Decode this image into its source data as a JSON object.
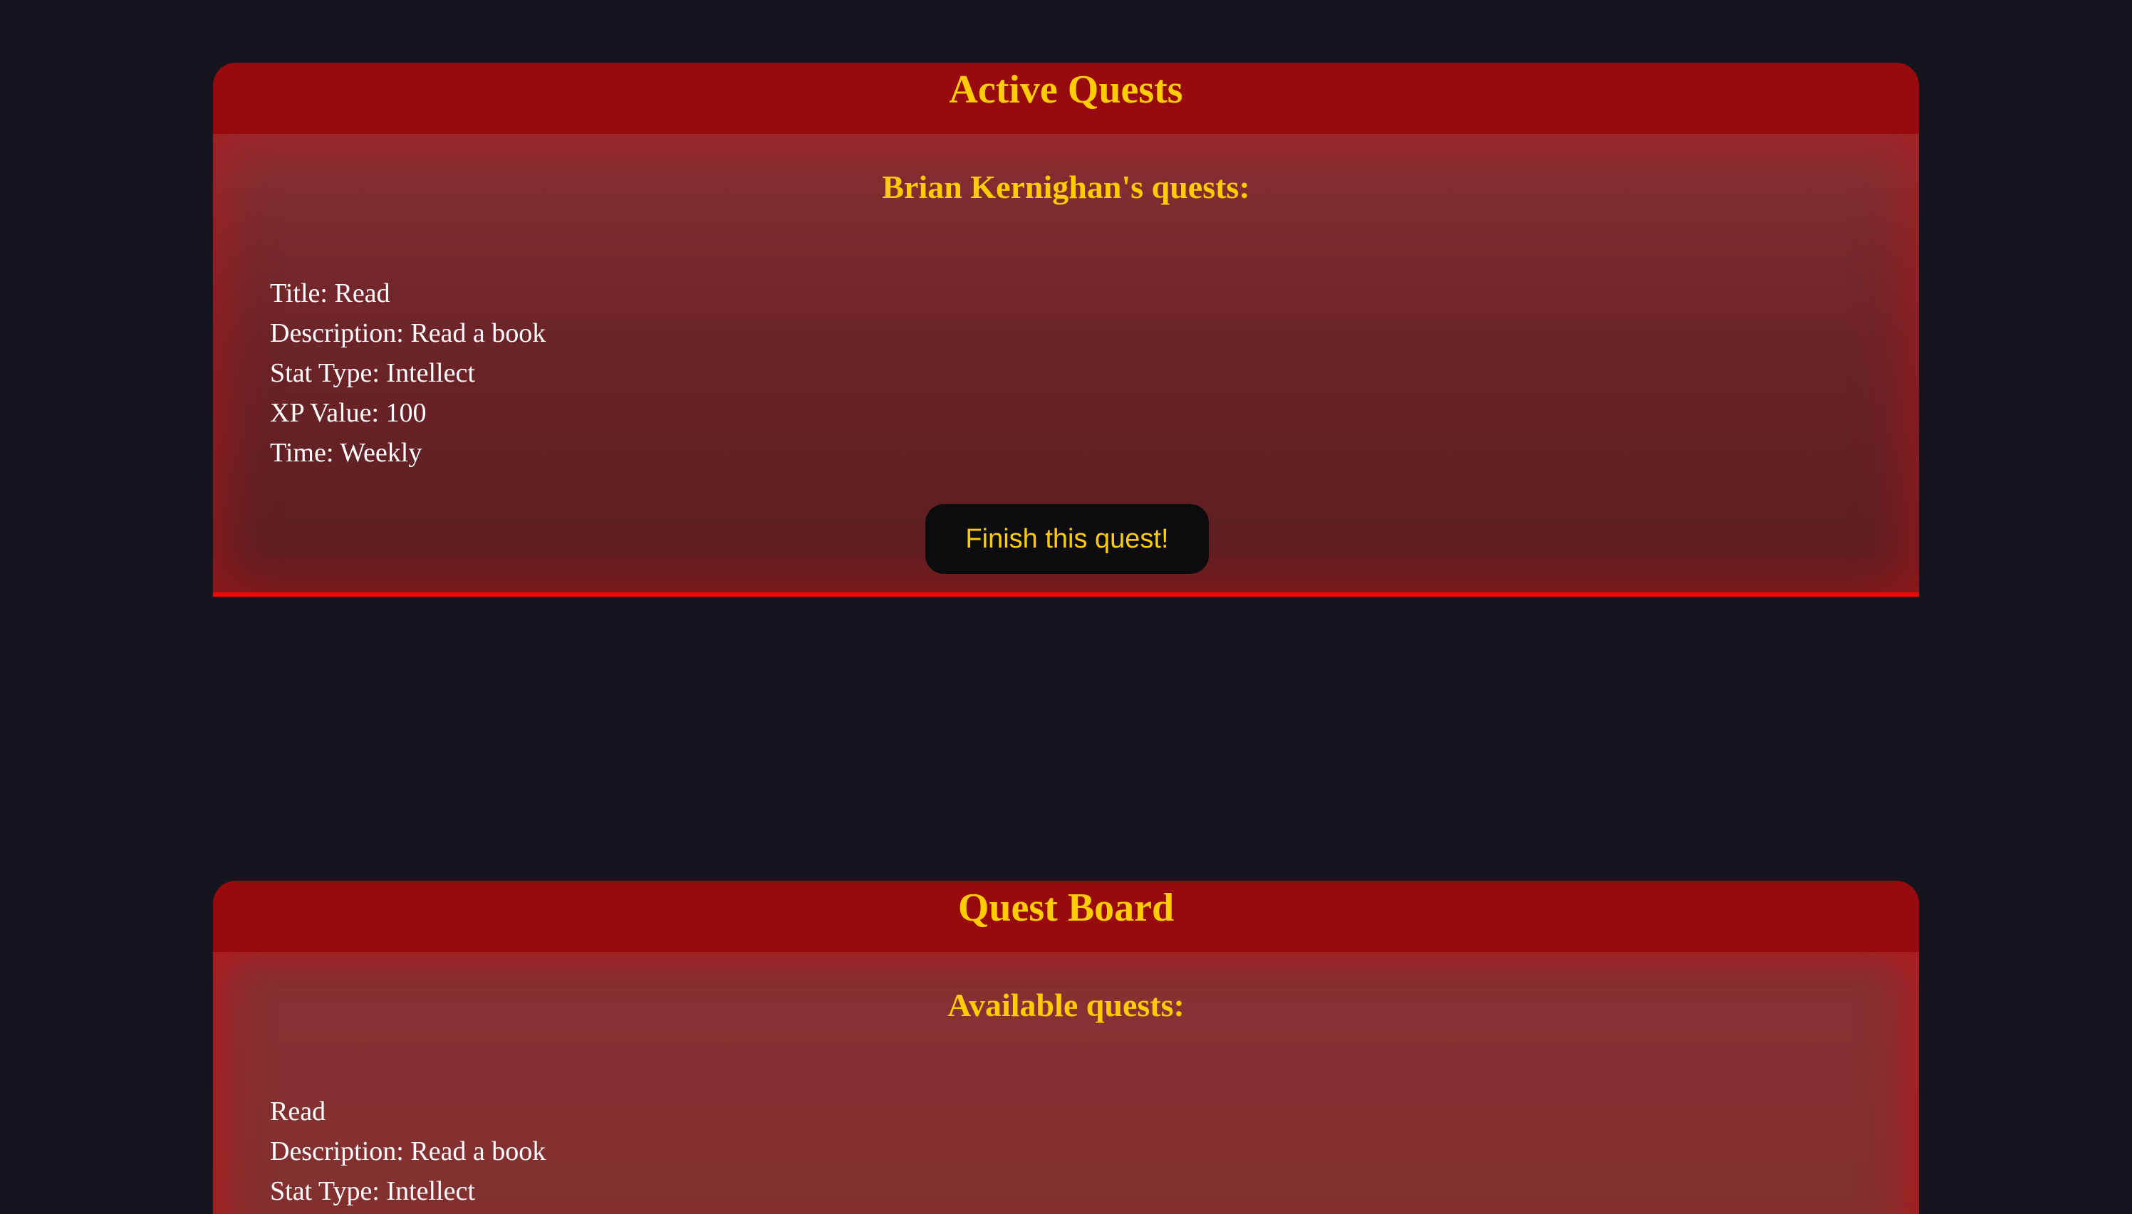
{
  "active_quests": {
    "title": "Active Quests",
    "heading": "Brian Kernighan's quests:",
    "quest": {
      "title_line": "Title: Read",
      "description_line": "Description: Read a book",
      "stat_type_line": "Stat Type: Intellect",
      "xp_value_line": "XP Value: 100",
      "time_line": "Time: Weekly"
    },
    "finish_button_label": "Finish this quest!"
  },
  "quest_board": {
    "title": "Quest Board",
    "heading": "Available quests:",
    "quest": {
      "title_line": "Read",
      "description_line": "Description: Read a book",
      "stat_type_line": "Stat Type: Intellect"
    }
  },
  "colors": {
    "page_background": "#14151d",
    "header_red": "#990a0e",
    "accent_yellow": "#ffcc00",
    "border_red": "#ff0000",
    "button_background": "#0c0c0f"
  }
}
